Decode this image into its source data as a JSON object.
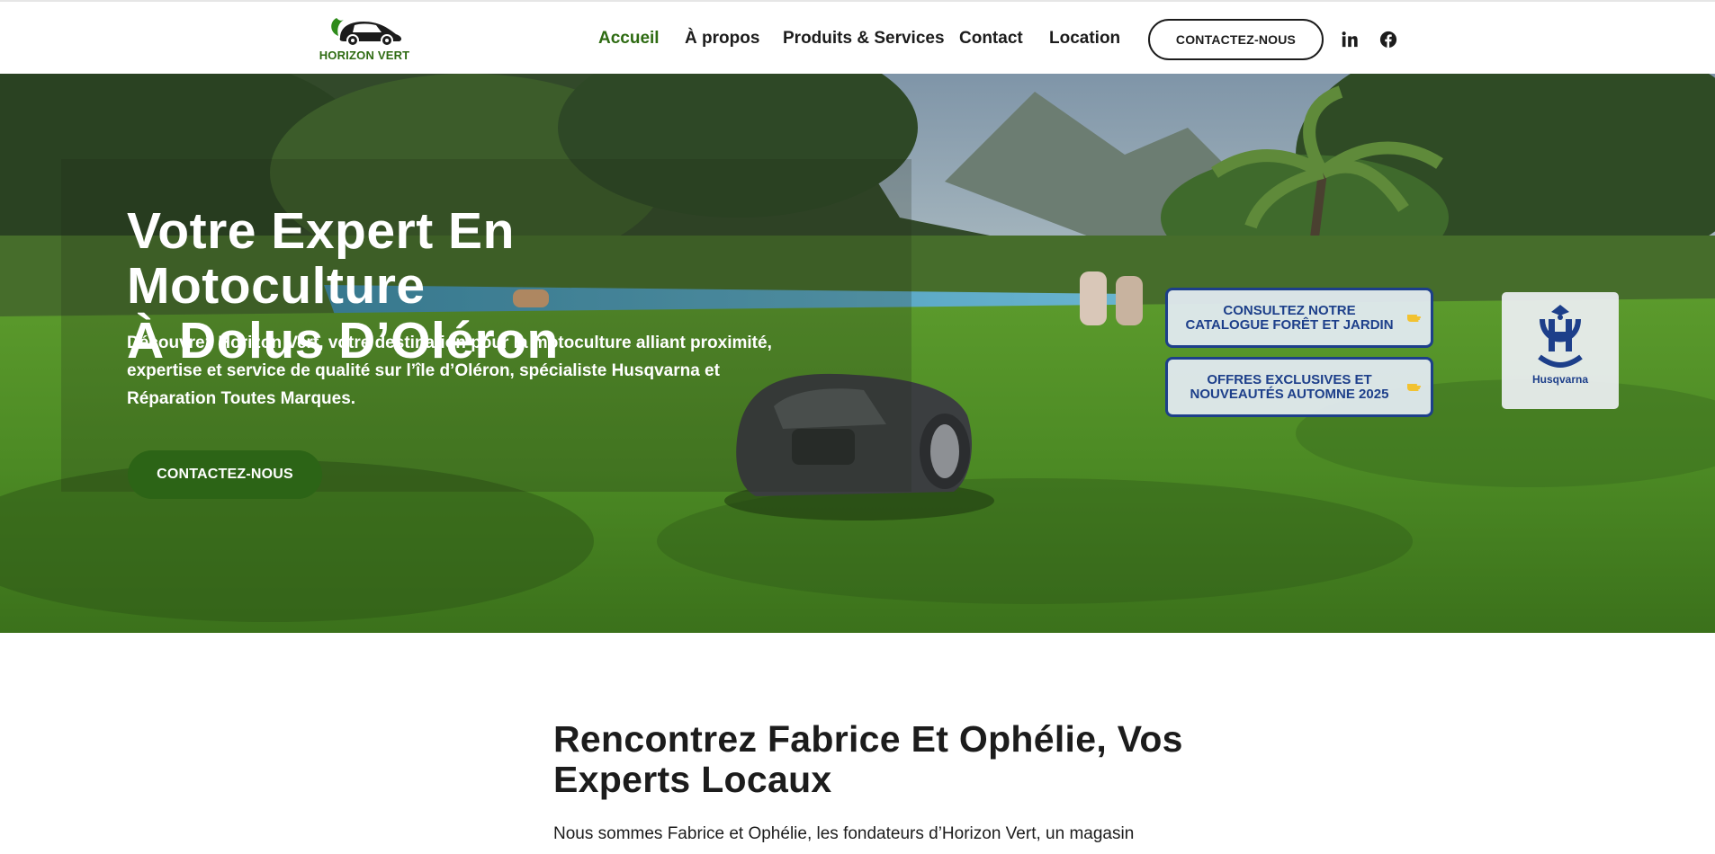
{
  "header": {
    "logo_text": "HORIZON VERT",
    "nav": [
      {
        "label": "Accueil",
        "active": true
      },
      {
        "label": "À propos",
        "active": false
      },
      {
        "label": "Produits & Services",
        "active": false
      },
      {
        "label": "Contact",
        "active": false
      },
      {
        "label": "Location",
        "active": false
      }
    ],
    "cta_label": "CONTACTEZ-NOUS",
    "social": [
      {
        "icon": "linkedin-icon",
        "glyph": "in"
      },
      {
        "icon": "facebook-icon",
        "glyph": "f"
      }
    ]
  },
  "hero": {
    "title_line1": "Votre Expert En Motoculture",
    "title_line2": "À Dolus D’Oléron",
    "description": "Découvrez Horizon Vert, votre destination pour la motoculture alliant proximité, expertise et service de qualité sur l’île d’Oléron, spécialiste Husqvarna et Réparation Toutes Marques.",
    "cta_label": "CONTACTEZ-NOUS",
    "promos": [
      {
        "line1": "CONSULTEZ NOTRE",
        "line2": "CATALOGUE FORÊT ET JARDIN"
      },
      {
        "line1": "OFFRES EXCLUSIVES ET",
        "line2": "NOUVEAUTÉS AUTOMNE 2025"
      }
    ],
    "brand_badge": "Husqvarna"
  },
  "about": {
    "title_line1": "Rencontrez Fabrice Et Ophélie, Vos",
    "title_line2": "Experts Locaux",
    "text": "Nous sommes Fabrice et Ophélie, les fondateurs d’Horizon Vert, un magasin"
  },
  "colors": {
    "brand_green": "#2c6416",
    "active_nav": "#2e6b12",
    "promo_blue": "#1d3f8a"
  }
}
